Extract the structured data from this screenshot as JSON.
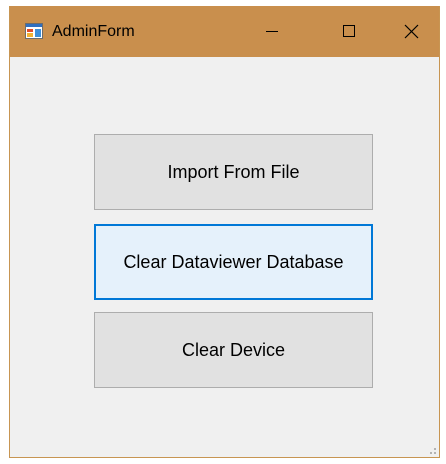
{
  "window": {
    "title": "AdminForm",
    "title_icon": "winforms-app-icon",
    "caption_buttons": {
      "minimize_icon": "minimize-icon",
      "maximize_icon": "maximize-icon",
      "close_icon": "close-icon"
    },
    "titlebar_color": "#c98f4d"
  },
  "buttons": {
    "import_label": "Import From File",
    "clear_db_label": "Clear Dataviewer Database",
    "clear_device_label": "Clear Device"
  },
  "colors": {
    "focus_border": "#0078d7",
    "button_face": "#e1e1e1",
    "form_background": "#f0f0f0"
  }
}
